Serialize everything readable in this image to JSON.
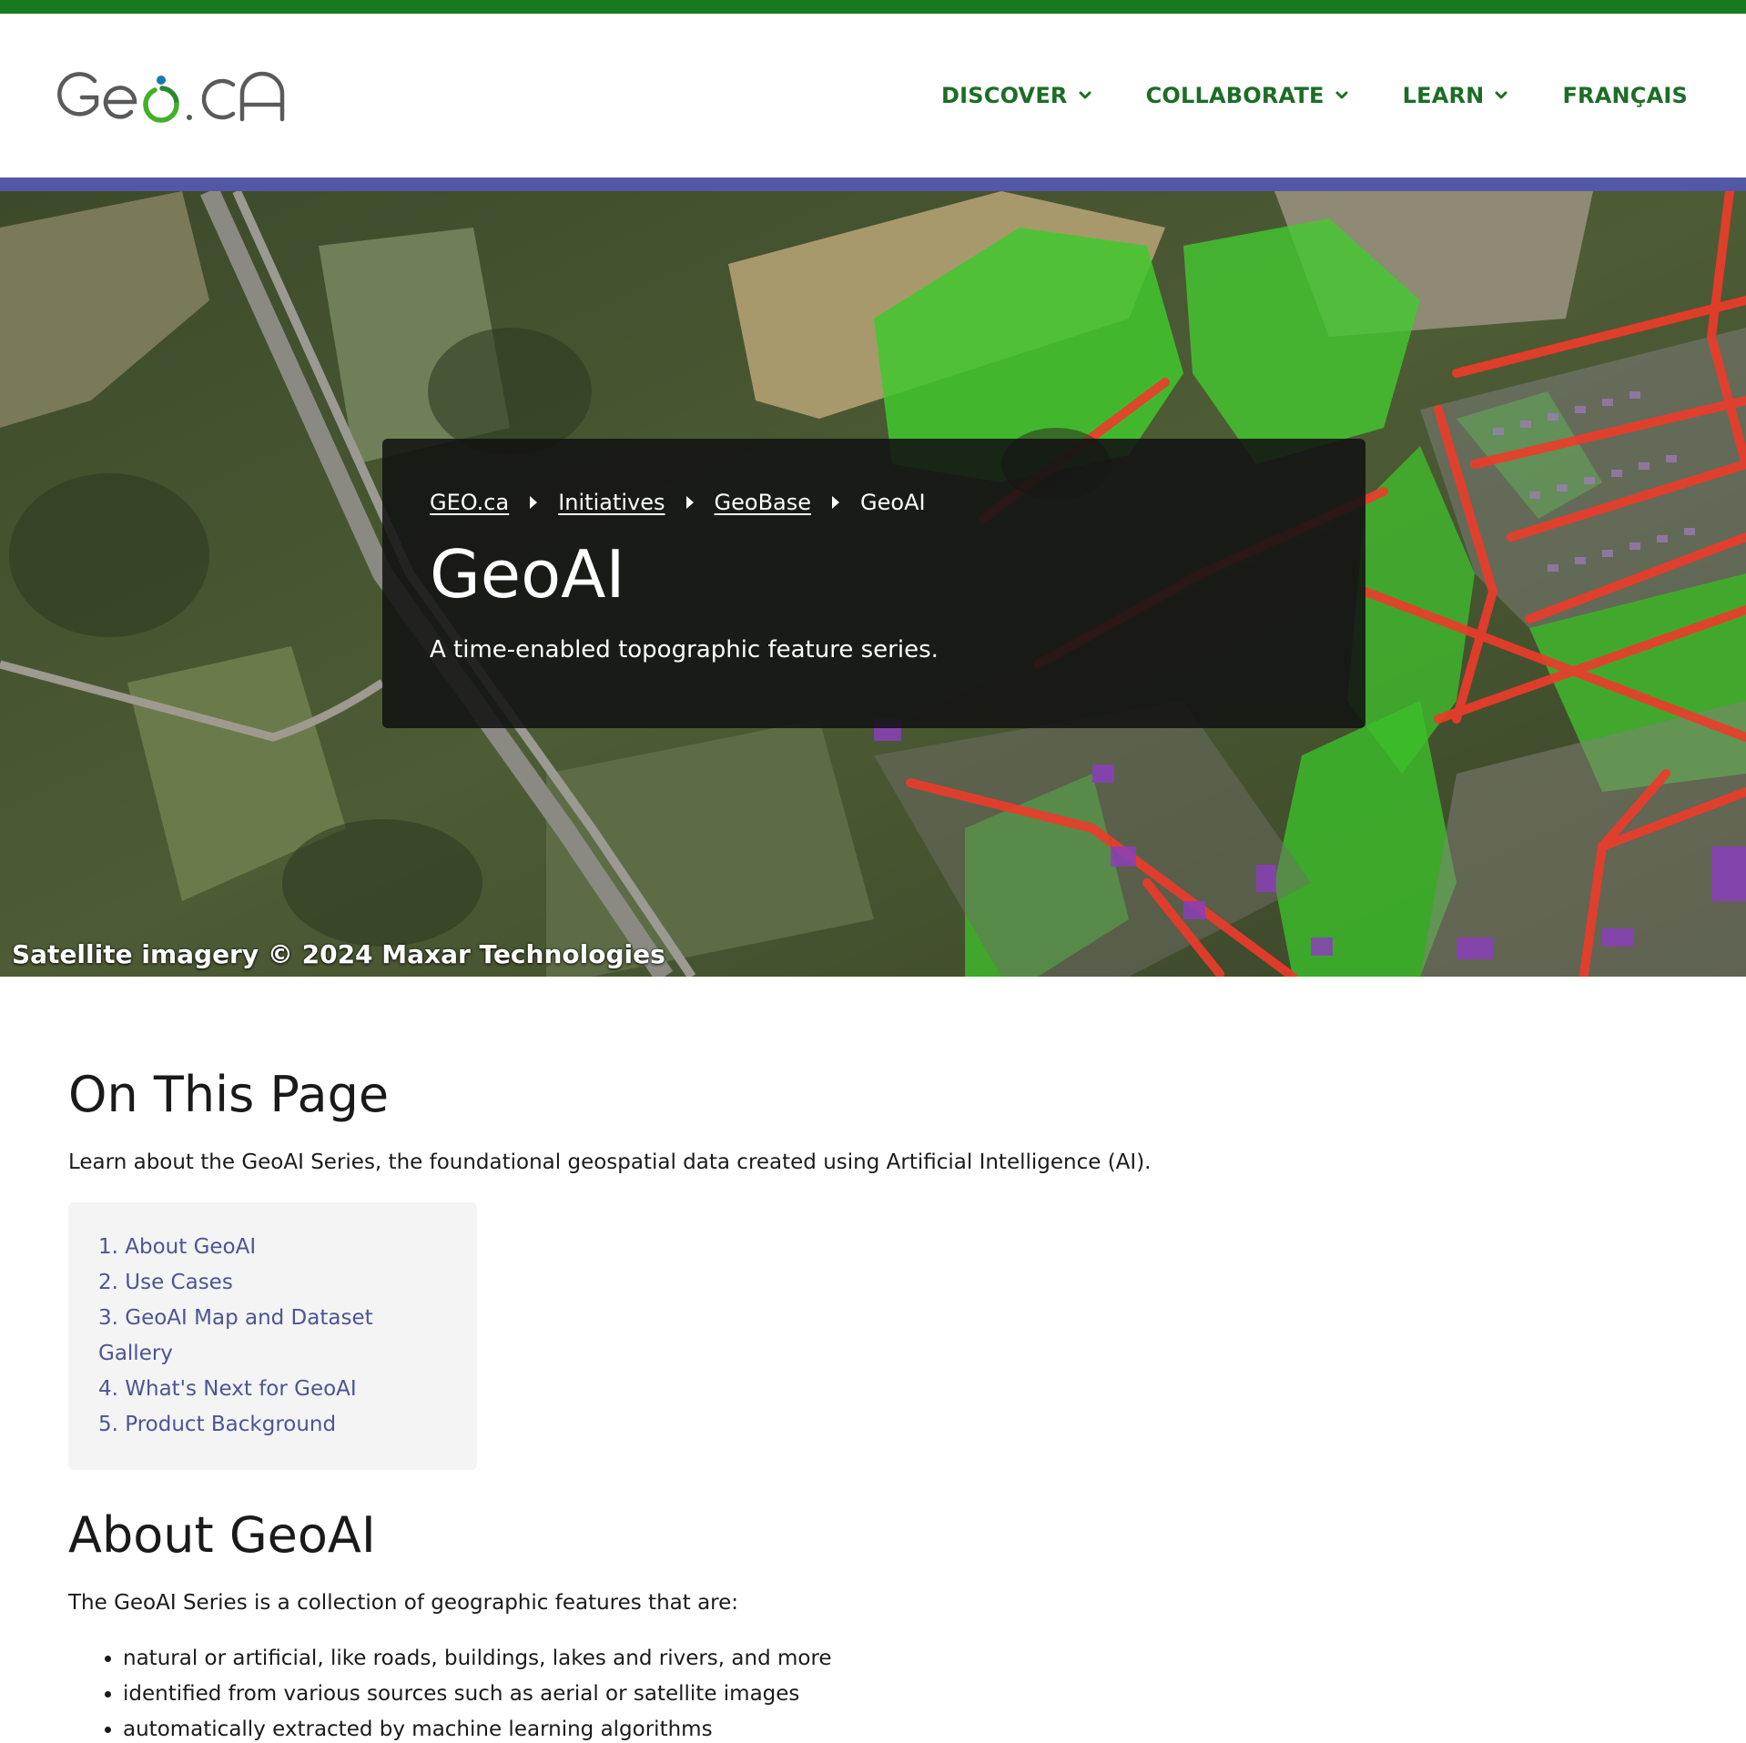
{
  "header": {
    "logo_text": "GEO.CA",
    "nav": [
      {
        "label": "DISCOVER",
        "has_dropdown": true
      },
      {
        "label": "COLLABORATE",
        "has_dropdown": true
      },
      {
        "label": "LEARN",
        "has_dropdown": true
      },
      {
        "label": "FRANÇAIS",
        "has_dropdown": false
      }
    ]
  },
  "colors": {
    "brand_green": "#177a21",
    "nav_green": "#1c6d26",
    "accent_purple": "#5358a6",
    "toc_link": "#4b5594"
  },
  "hero": {
    "breadcrumb": [
      {
        "label": "GEO.ca",
        "link": true
      },
      {
        "label": "Initiatives",
        "link": true
      },
      {
        "label": "GeoBase",
        "link": true
      },
      {
        "label": "GeoAI",
        "link": false
      }
    ],
    "title": "GeoAI",
    "subtitle": "A time-enabled topographic feature series.",
    "credit": "Satellite imagery © 2024 Maxar Technologies"
  },
  "on_this_page": {
    "title": "On This Page",
    "intro": "Learn about the GeoAI Series, the foundational geospatial data created using Artificial Intelligence (AI).",
    "toc": [
      "1. About GeoAI",
      "2. Use Cases",
      "3. GeoAI Map and Dataset Gallery",
      "4. What's Next for GeoAI",
      "5. Product Background"
    ]
  },
  "about": {
    "title": "About GeoAI",
    "intro": "The GeoAI Series is a collection of geographic features that are:",
    "bullets": [
      "natural or artificial, like roads, buildings, lakes and rivers, and more",
      "identified from various sources such as aerial or satellite images",
      "automatically extracted by machine learning algorithms"
    ]
  }
}
